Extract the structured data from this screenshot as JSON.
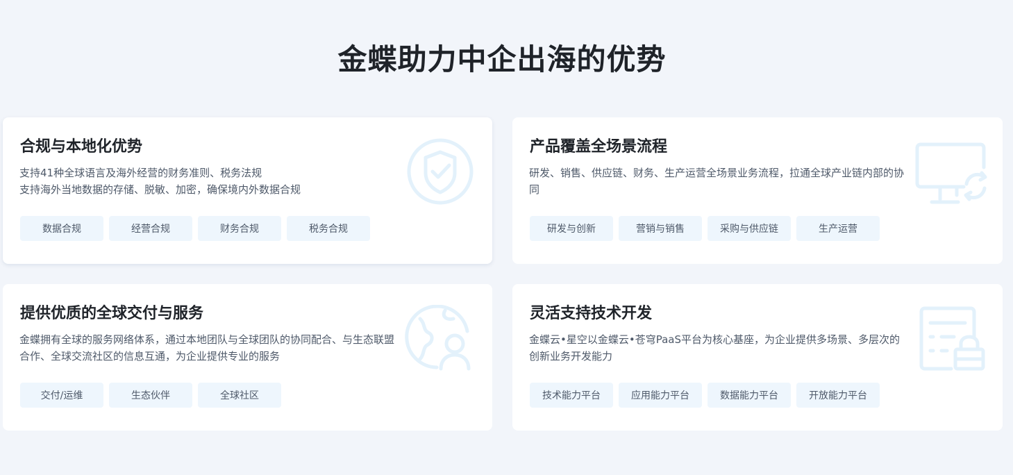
{
  "section": {
    "title": "金蝶助力中企出海的优势"
  },
  "cards": [
    {
      "title": "合规与本地化优势",
      "desc": [
        "支持41种全球语言及海外经营的财务准则、税务法规",
        "支持海外当地数据的存储、脱敏、加密，确保境内外数据合规"
      ],
      "tags": [
        "数据合规",
        "经营合规",
        "财务合规",
        "税务合规"
      ],
      "icon": "shield-check-icon"
    },
    {
      "title": "产品覆盖全场景流程",
      "desc": [
        "研发、销售、供应链、财务、生产运营全场景业务流程，拉通全球产业链内部的协同"
      ],
      "tags": [
        "研发与创新",
        "营销与销售",
        "采购与供应链",
        "生产运营"
      ],
      "icon": "monitor-sync-icon"
    },
    {
      "title": "提供优质的全球交付与服务",
      "desc": [
        "金蝶拥有全球的服务网络体系，通过本地团队与全球团队的协同配合、与生态联盟合作、全球交流社区的信息互通，为企业提供专业的服务"
      ],
      "tags": [
        "交付/运维",
        "生态伙伴",
        "全球社区"
      ],
      "icon": "globe-user-icon"
    },
    {
      "title": "灵活支持技术开发",
      "desc": [
        "金蝶云•星空以金蝶云•苍穹PaaS平台为核心基座，为企业提供多场景、多层次的创新业务开发能力"
      ],
      "tags": [
        "技术能力平台",
        "应用能力平台",
        "数据能力平台",
        "开放能力平台"
      ],
      "icon": "document-lock-icon"
    }
  ],
  "colors": {
    "background": "#f2f5fa",
    "card": "#ffffff",
    "tag_bg": "#eef6fd",
    "icon": "#e3f1fb",
    "title": "#1f2329",
    "text": "#4e5969"
  }
}
